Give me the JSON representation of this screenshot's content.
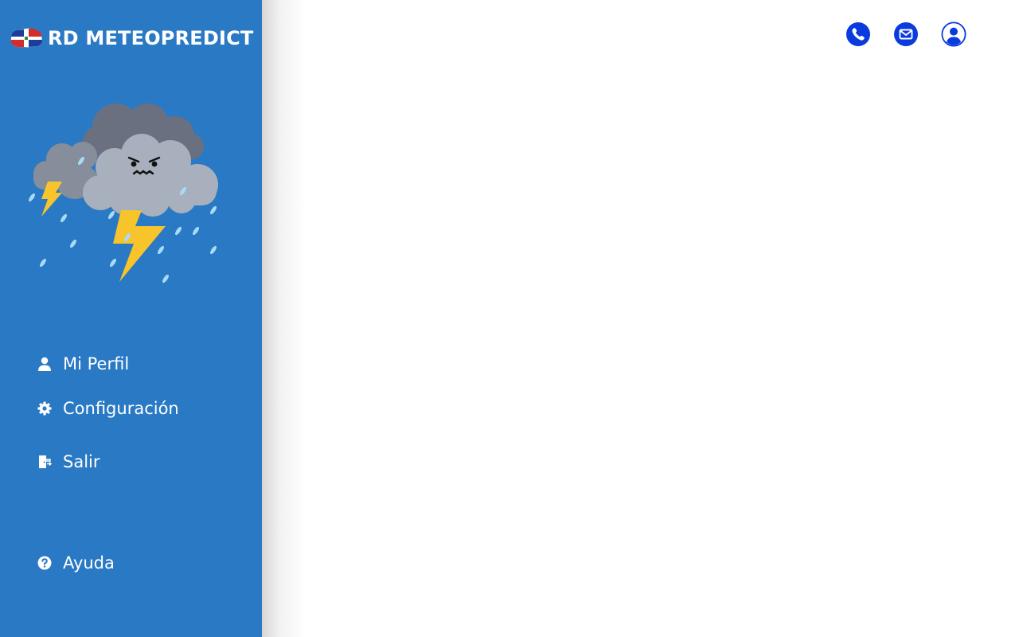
{
  "brand": {
    "name": "RD METEOPREDICT",
    "flag_icon": "dominican-flag-icon"
  },
  "illustration": {
    "icon": "storm-cloud-icon"
  },
  "nav": {
    "profile": {
      "label": "Mi Perfil",
      "icon": "user-icon"
    },
    "settings": {
      "label": "Configuración",
      "icon": "gear-icon"
    },
    "logout": {
      "label": "Salir",
      "icon": "logout-icon"
    },
    "help": {
      "label": "Ayuda",
      "icon": "help-icon"
    }
  },
  "topbar": {
    "buttons": [
      {
        "icon": "phone-icon"
      },
      {
        "icon": "mail-icon"
      },
      {
        "icon": "account-icon"
      }
    ]
  },
  "colors": {
    "sidebar_bg": "#2a79c4",
    "topbar_icon": "#0b3bdf",
    "bolt": "#f7c42c",
    "raindrop": "#a7dcf7",
    "cloud_light": "#a9b0bd",
    "cloud_dark": "#6b7080"
  }
}
